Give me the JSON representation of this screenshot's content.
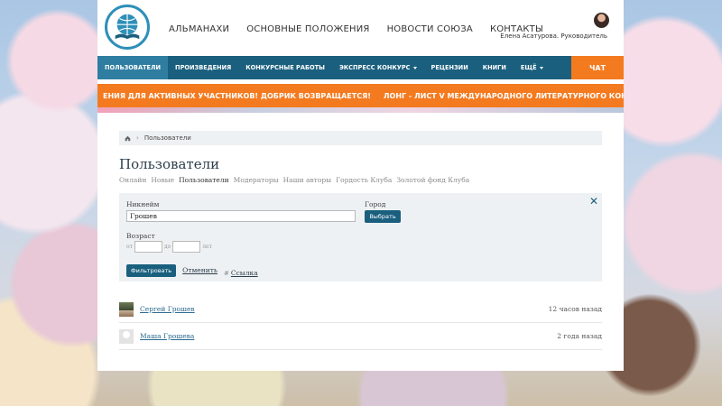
{
  "header": {
    "top_nav": [
      "АЛЬМАНАХИ",
      "ОСНОВНЫЕ ПОЛОЖЕНИЯ",
      "НОВОСТИ СОЮЗА",
      "КОНТАКТЫ"
    ],
    "user_name": "Елена Асатурова. Руководитель"
  },
  "main_nav": {
    "items": [
      "ПОЛЬЗОВАТЕЛИ",
      "ПРОИЗВЕДЕНИЯ",
      "КОНКУРСНЫЕ РАБОТЫ",
      "ЭКСПРЕСС КОНКУРС",
      "РЕЦЕНЗИИ",
      "КНИГИ",
      "ЕЩЁ"
    ],
    "chat": "ЧАТ"
  },
  "ticker": {
    "text1": "ЕНИЯ ДЛЯ АКТИВНЫХ УЧАСТНИКОВ! ДОБРИК ВОЗВРАЩАЕТСЯ!",
    "text2": "ЛОНГ - ЛИСТ V МЕЖДУНАРОДНОГО ЛИТЕРАТУРНОГО КОНКУРСА «СЛАВЯНСКОЕ СЛ"
  },
  "breadcrumb": {
    "current": "Пользователи"
  },
  "page_title": "Пользователи",
  "tabs": [
    "Онлайн",
    "Новые",
    "Пользователи",
    "Модераторы",
    "Наши авторы",
    "Гордость Клуба",
    "Золотой фонд Клуба"
  ],
  "filter": {
    "nick_label": "Никнейм",
    "nick_value": "Грошев",
    "city_label": "Город",
    "choose_label": "Выбрать",
    "age_label": "Возраст",
    "from": "от",
    "to": "до",
    "years": "лет",
    "filter_button": "Фильтровать",
    "cancel": "Отменить",
    "link": "Ссылка"
  },
  "users": [
    {
      "name": "Сергей Грошев",
      "time": "12 часов назад"
    },
    {
      "name": "Маша Грошева",
      "time": "2 года назад"
    }
  ]
}
